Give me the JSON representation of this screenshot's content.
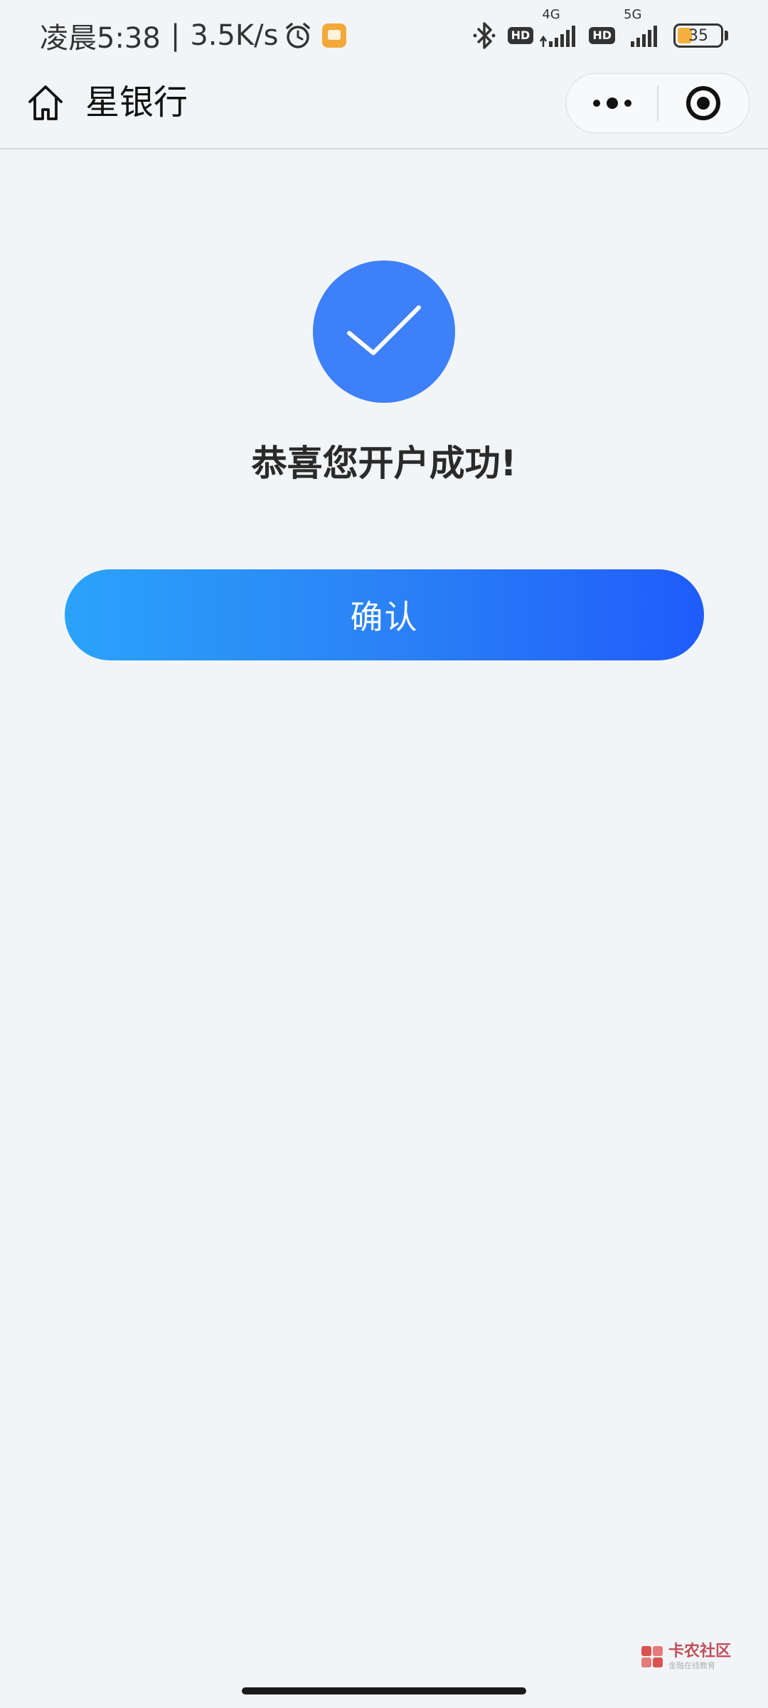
{
  "status_bar": {
    "time": "凌晨5:38",
    "separator": "|",
    "net_speed": "3.5K/s",
    "hd1": "HD",
    "net1": "4G",
    "hd2": "HD",
    "net2": "5G",
    "battery": "35",
    "battery_level": 0.35,
    "battery_color": "#f4b13e"
  },
  "header": {
    "title": "星银行"
  },
  "result": {
    "title": "恭喜您开户成功!",
    "icon": "check-icon",
    "icon_color": "#3e7ffa"
  },
  "actions": {
    "confirm_label": "确认"
  },
  "watermark": {
    "main": "卡农社区",
    "sub": "金融在线教育"
  }
}
